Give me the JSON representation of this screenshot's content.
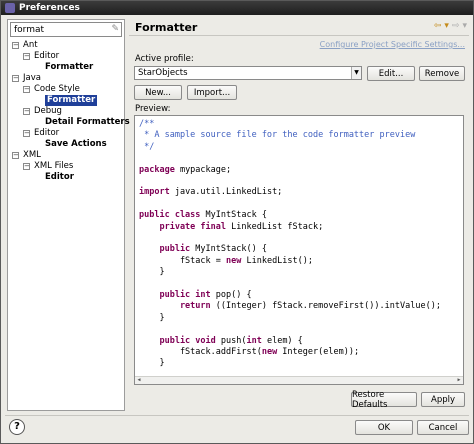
{
  "window": {
    "title": "Preferences"
  },
  "filter": {
    "value": "format"
  },
  "tree": [
    {
      "label": "Ant",
      "level": 0,
      "toggle": "−",
      "bold": false,
      "selected": false
    },
    {
      "label": "Editor",
      "level": 1,
      "toggle": "−",
      "bold": false,
      "selected": false
    },
    {
      "label": "Formatter",
      "level": 2,
      "toggle": "",
      "bold": true,
      "selected": false
    },
    {
      "label": "Java",
      "level": 0,
      "toggle": "−",
      "bold": false,
      "selected": false
    },
    {
      "label": "Code Style",
      "level": 1,
      "toggle": "−",
      "bold": false,
      "selected": false
    },
    {
      "label": "Formatter",
      "level": 2,
      "toggle": "",
      "bold": true,
      "selected": true
    },
    {
      "label": "Debug",
      "level": 1,
      "toggle": "−",
      "bold": false,
      "selected": false
    },
    {
      "label": "Detail Formatters",
      "level": 2,
      "toggle": "",
      "bold": true,
      "selected": false
    },
    {
      "label": "Editor",
      "level": 1,
      "toggle": "−",
      "bold": false,
      "selected": false
    },
    {
      "label": "Save Actions",
      "level": 2,
      "toggle": "",
      "bold": true,
      "selected": false
    },
    {
      "label": "XML",
      "level": 0,
      "toggle": "−",
      "bold": false,
      "selected": false
    },
    {
      "label": "XML Files",
      "level": 1,
      "toggle": "−",
      "bold": false,
      "selected": false
    },
    {
      "label": "Editor",
      "level": 2,
      "toggle": "",
      "bold": true,
      "selected": false
    }
  ],
  "page": {
    "title": "Formatter",
    "config_link": "Configure Project Specific Settings...",
    "active_profile_label": "Active profile:",
    "profile_value": "StarObjects",
    "edit_label": "Edit...",
    "remove_label": "Remove",
    "new_label": "New...",
    "import_label": "Import...",
    "preview_label": "Preview:"
  },
  "code_lines": [
    {
      "text": "/**",
      "kind": "comment"
    },
    {
      "text": " * A sample source file for the code formatter preview",
      "kind": "comment"
    },
    {
      "text": " */",
      "kind": "comment"
    },
    {
      "text": "",
      "kind": "plain"
    },
    {
      "kw": "package",
      "text": " mypackage;",
      "kind": "kwline"
    },
    {
      "text": "",
      "kind": "plain"
    },
    {
      "kw": "import",
      "text": " java.util.LinkedList;",
      "kind": "kwline"
    },
    {
      "text": "",
      "kind": "plain"
    },
    {
      "kw": "public class",
      "text": " MyIntStack {",
      "kind": "kwline"
    },
    {
      "kw": "    private final",
      "text": " LinkedList fStack;",
      "kind": "kwline"
    },
    {
      "text": "",
      "kind": "plain"
    },
    {
      "kw": "    public",
      "text": " MyIntStack() {",
      "kind": "kwline"
    },
    {
      "pre": "        fStack = ",
      "kw": "new",
      "text": " LinkedList();",
      "kind": "midkw"
    },
    {
      "text": "    }",
      "kind": "plain"
    },
    {
      "text": "",
      "kind": "plain"
    },
    {
      "kw": "    public int",
      "text": " pop() {",
      "kind": "kwline"
    },
    {
      "kw": "        return",
      "text": " ((Integer) fStack.removeFirst()).intValue();",
      "kind": "kwline"
    },
    {
      "text": "    }",
      "kind": "plain"
    },
    {
      "text": "",
      "kind": "plain"
    },
    {
      "kw": "    public void",
      "pre2": " push(",
      "kw2": "int",
      "text": " elem) {",
      "kind": "twokw"
    },
    {
      "pre": "        fStack.addFirst(",
      "kw": "new",
      "text": " Integer(elem));",
      "kind": "midkw"
    },
    {
      "text": "    }",
      "kind": "plain"
    }
  ],
  "buttons": {
    "restore_defaults": "Restore Defaults",
    "apply": "Apply",
    "ok": "OK",
    "cancel": "Cancel"
  },
  "help": {
    "label": "?"
  },
  "colors": {
    "selection": "#1f3f99",
    "comment": "#3f5fbf",
    "keyword": "#7f0055"
  }
}
